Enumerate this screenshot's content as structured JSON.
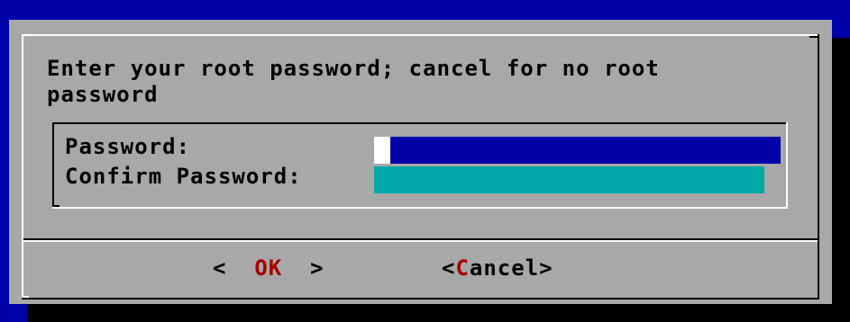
{
  "dialog": {
    "prompt": "Enter your root password; cancel for no root\npassword"
  },
  "form": {
    "password_label": "Password:",
    "confirm_label": "Confirm Password:",
    "password_value": "",
    "confirm_value": ""
  },
  "buttons": {
    "ok": {
      "left": "<  ",
      "label": "OK",
      "right": "  >"
    },
    "cancel": {
      "left": "<",
      "hotkey": "C",
      "rest": "ancel",
      "right": ">"
    }
  },
  "colors": {
    "background": "#0000a8",
    "dialog": "#a8a8a8",
    "active_field": "#0000a8",
    "inactive_field": "#00a8a8",
    "hotkey": "#a80000"
  }
}
